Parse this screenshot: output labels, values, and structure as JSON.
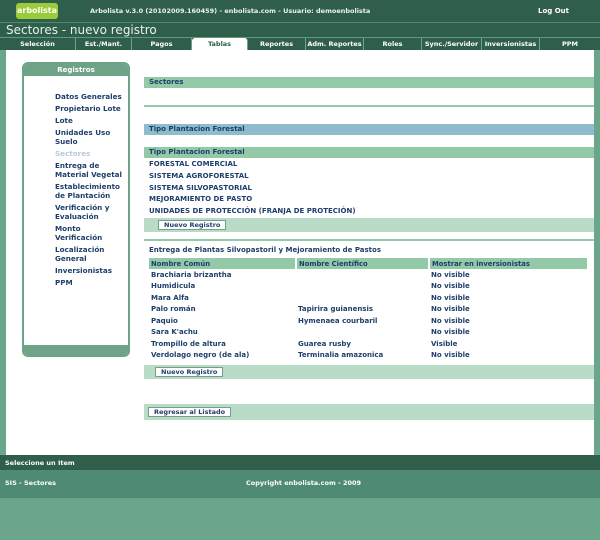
{
  "header": {
    "logo": "arbolista",
    "info": "Arbolista v.3.0 (20102009.160459) - enbolista.com - Usuario: demoenbolista",
    "logout": "Log Out",
    "title": "Sectores - nuevo registro"
  },
  "menu": [
    {
      "label": "Selección"
    },
    {
      "label": "Est./Mant."
    },
    {
      "label": "Pagos"
    },
    {
      "label": "Tablas"
    },
    {
      "label": "Reportes"
    },
    {
      "label": "Adm. Reportes"
    },
    {
      "label": "Roles"
    },
    {
      "label": "Sync./Servidor"
    },
    {
      "label": "Inversionistas"
    },
    {
      "label": "PPM"
    }
  ],
  "sidebar": {
    "title": "Registros",
    "items": [
      {
        "label": "Datos Generales"
      },
      {
        "label": "Propietario Lote"
      },
      {
        "label": "Lote"
      },
      {
        "label": "Unidades Uso Suelo"
      },
      {
        "label": "Sectores"
      },
      {
        "label": "Entrega de Material Vegetal"
      },
      {
        "label": "Establecimiento de Plantación"
      },
      {
        "label": "Verificación y Evaluación"
      },
      {
        "label": "Monto Verificación"
      },
      {
        "label": "Localización General"
      },
      {
        "label": "Inversionistas"
      },
      {
        "label": "PPM"
      }
    ]
  },
  "main": {
    "section_title": "Sectores",
    "tipo_title": "Tipo Plantacion Forestal",
    "tipo_header": "Tipo Plantacion Forestal",
    "tipos": [
      "FORESTAL COMERCIAL",
      "SISTEMA AGROFORESTAL",
      "SISTEMA SILVOPASTORIAL",
      "MEJORAMIENTO DE PASTO",
      "UNIDADES DE PROTECCIÓN (FRANJA DE PROTECIÓN)"
    ],
    "new_record": "Nuevo Registro",
    "plantas_title": "Entrega de Plantas Silvopastoril y Mejoramiento de Pastos",
    "columns": [
      "Nombre Común",
      "Nombre Científico",
      "Mostrar en inversionistas"
    ],
    "plantas": [
      [
        "Brachiaria brizantha",
        "",
        "No visible"
      ],
      [
        "Humidicula",
        "",
        "No visible"
      ],
      [
        "Mara Alfa",
        "",
        "No visible"
      ],
      [
        "Palo román",
        "Tapirira guianensis",
        "No visible"
      ],
      [
        "Paquio",
        "Hymenaea courbaril",
        "No visible"
      ],
      [
        "Sara K'achu",
        "",
        "No visible"
      ],
      [
        "Trompillo de altura",
        "Guarea rusby",
        "Visible"
      ],
      [
        "Verdolago negro (de ala)",
        "Terminalia amazonica",
        "No visible"
      ]
    ],
    "back_button": "Regresar al Listado"
  },
  "status": {
    "text": "Seleccione un Item",
    "footer_left": "SIS - Sectores",
    "footer_center": "Copyright enbolista.com - 2009"
  }
}
